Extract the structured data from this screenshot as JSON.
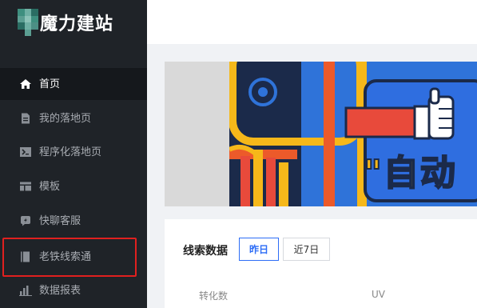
{
  "brand": {
    "name": "魔力建站"
  },
  "sidebar": {
    "items": [
      {
        "label": "首页",
        "icon": "home-icon",
        "active": true
      },
      {
        "label": "我的落地页",
        "icon": "document-icon",
        "active": false
      },
      {
        "label": "程序化落地页",
        "icon": "program-icon",
        "active": false
      },
      {
        "label": "模板",
        "icon": "template-icon",
        "active": false
      },
      {
        "label": "快聊客服",
        "icon": "chat-icon",
        "active": false
      },
      {
        "label": "老铁线索通",
        "icon": "book-icon",
        "active": false
      },
      {
        "label": "数据报表",
        "icon": "bar-chart-icon",
        "active": false
      }
    ]
  },
  "banner": {
    "text": "\"自动"
  },
  "leads": {
    "title": "线索数据",
    "tabs": [
      {
        "label": "昨日",
        "active": true
      },
      {
        "label": "近7日",
        "active": false
      }
    ],
    "columns": [
      "转化数",
      "UV"
    ]
  },
  "colors": {
    "sidebar_bg": "#1f2328",
    "accent": "#2d6df6",
    "highlight": "#e0201f"
  }
}
